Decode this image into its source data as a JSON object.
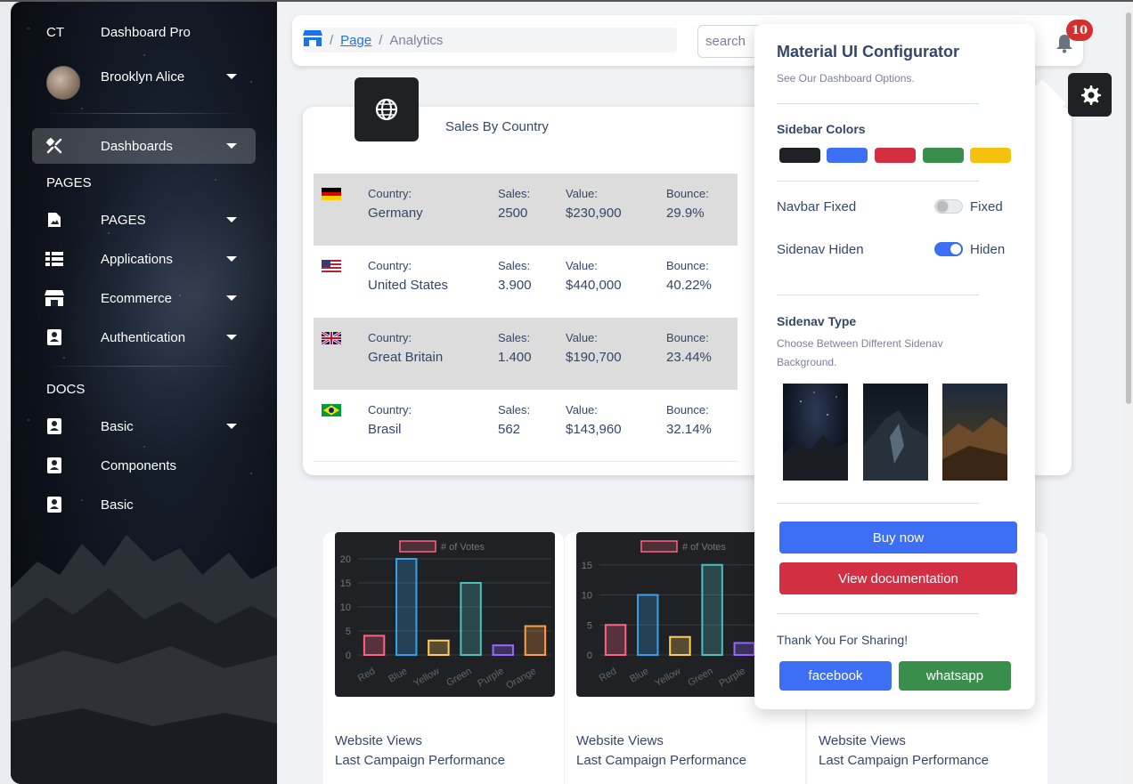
{
  "sidebar": {
    "brand_short": "CT",
    "brand_name": "Dashboard Pro",
    "user_name": "Brooklyn Alice",
    "active_item": "Dashboards",
    "section_pages": "PAGES",
    "section_docs": "DOCS",
    "items": [
      {
        "label": "PAGES",
        "icon": "image-icon"
      },
      {
        "label": "Applications",
        "icon": "grid-list-icon"
      },
      {
        "label": "Ecommerce",
        "icon": "store-icon"
      },
      {
        "label": "Authentication",
        "icon": "contact-card-icon"
      }
    ],
    "docs": [
      {
        "label": "Basic",
        "icon": "contact-card-icon"
      },
      {
        "label": "Components",
        "icon": "contact-card-icon"
      },
      {
        "label": "Basic",
        "icon": "contact-card-icon"
      }
    ]
  },
  "navbar": {
    "breadcrumb_page": "Page",
    "breadcrumb_current": "Analytics",
    "search_placeholder": "search",
    "notification_count": "10"
  },
  "sales_card": {
    "title": "Sales By Country",
    "headers": {
      "country": "Country:",
      "sales": "Sales:",
      "value": "Value:",
      "bounce": "Bounce:"
    },
    "rows": [
      {
        "country": "Germany",
        "sales": "2500",
        "value": "$230,900",
        "bounce": "29.9%",
        "flag": "de"
      },
      {
        "country": "United States",
        "sales": "3.900",
        "value": "$440,000",
        "bounce": "40.22%",
        "flag": "us"
      },
      {
        "country": "Great Britain",
        "sales": "1.400",
        "value": "$190,700",
        "bounce": "23.44%",
        "flag": "gb"
      },
      {
        "country": "Brasil",
        "sales": "562",
        "value": "$143,960",
        "bounce": "32.14%",
        "flag": "br"
      }
    ]
  },
  "chart_data": [
    {
      "type": "bar",
      "legend": "# of Votes",
      "categories": [
        "Red",
        "Blue",
        "Yellow",
        "Green",
        "Purple",
        "Orange"
      ],
      "values": [
        4,
        20,
        3,
        15,
        2,
        6
      ],
      "ylim": [
        0,
        20
      ],
      "yticks": [
        0,
        5,
        10,
        15,
        20
      ],
      "colors": [
        "#ff6384",
        "#36a2eb",
        "#ffce56",
        "#4bc0c0",
        "#9966ff",
        "#ff9f40"
      ]
    },
    {
      "type": "bar",
      "legend": "# of Votes",
      "categories": [
        "Red",
        "Blue",
        "Yellow",
        "Green",
        "Purple"
      ],
      "values": [
        5,
        10,
        3,
        15,
        2
      ],
      "ylim": [
        0,
        16
      ],
      "yticks": [
        0,
        5,
        10,
        15
      ],
      "colors": [
        "#ff6384",
        "#36a2eb",
        "#ffce56",
        "#4bc0c0",
        "#9966ff"
      ]
    }
  ],
  "chart_cards": [
    {
      "title": "Website Views",
      "subtitle": "Last Campaign Performance"
    },
    {
      "title": "Website Views",
      "subtitle": "Last Campaign Performance"
    },
    {
      "title": "Website Views",
      "subtitle": "Last Campaign Performance"
    }
  ],
  "configurator": {
    "title": "Material UI Configurator",
    "subtitle": "See Our Dashboard Options.",
    "sidebar_colors_label": "Sidebar Colors",
    "swatches": [
      "#1f2124",
      "#3d6ff5",
      "#d32f43",
      "#388e4a",
      "#f5c10e"
    ],
    "navbar_fixed_label": "Navbar Fixed",
    "navbar_fixed_value": "Fixed",
    "navbar_fixed_on": false,
    "sidenav_hidden_label": "Sidenav Hiden",
    "sidenav_hidden_value": "Hiden",
    "sidenav_hidden_on": true,
    "sidenav_type_label": "Sidenav Type",
    "sidenav_type_desc_1": "Choose Between Different Sidenav",
    "sidenav_type_desc_2": "Background.",
    "buy_label": "Buy now",
    "docs_label": "View documentation",
    "thanks_label": "Thank You For Sharing!",
    "facebook_label": "facebook",
    "whatsapp_label": "whatsapp",
    "colors": {
      "primary": "#3d6ff5",
      "danger": "#d32f43",
      "success": "#388e4a"
    }
  }
}
